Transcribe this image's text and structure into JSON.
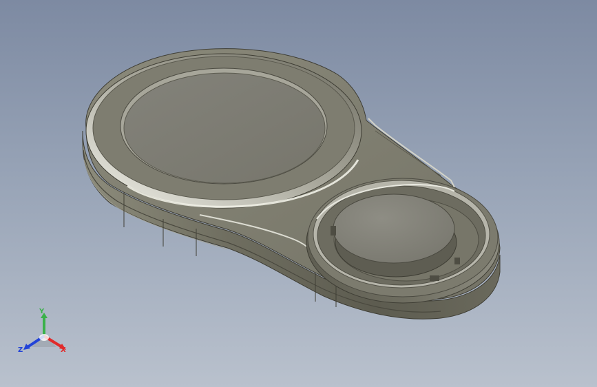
{
  "viewport": {
    "background_top": "#7d8aa2",
    "background_bottom": "#b9c1cd",
    "model_color": "#7c7b6c"
  },
  "model": {
    "name": "key-fob-housing",
    "large_recess": "circular-recess",
    "small_recess": "coin-cell-recess"
  },
  "triad": {
    "y_label": "Y",
    "z_label": "Z",
    "x_label": "X",
    "y_color": "#3bb14a",
    "z_color": "#2243d8",
    "x_color": "#e12a2a"
  }
}
